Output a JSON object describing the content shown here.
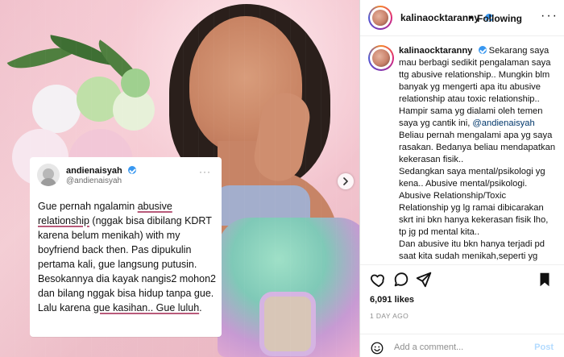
{
  "post": {
    "username": "kalinaocktaranny",
    "follow_state": "Following",
    "likes": "6,091 likes",
    "time_ago": "1 DAY AGO",
    "comment_placeholder": "Add a comment...",
    "post_label": "Post"
  },
  "caption": {
    "username": "kalinaocktaranny",
    "text_before_mention": "Sekarang saya mau berbagi sedikit pengalaman saya ttg abusive relationship.. Mungkin blm banyak yg mengerti apa itu abusive relationship atau toxic relationship.. Hampir sama yg dialami oleh temen saya yg cantik ini, ",
    "mention": "@andienaisyah",
    "text_after_mention": "\nBeliau pernah mengalami apa yg saya rasakan. Bedanya beliau mendapatkan kekerasan fisik..\nSedangkan saya mental/psikologi yg kena.. Abusive mental/psikologi.\nAbusive Relationship/Toxic Relationship yg lg ramai dibicarakan skrt ini bkn hanya kekerasan fisik lho, tp jg pd mental kita..\nDan abusive itu bkn hanya terjadi pd saat kita sudah menikah,seperti yg saya katakan dipostingan saya sebelumnya, jg bs terjadi saat pacaran"
  },
  "tweet": {
    "name": "andienaisyah",
    "handle": "@andienaisyah",
    "more": "···",
    "part1": "Gue pernah ngalamin ",
    "u1": "abusive relationship",
    "part2": " (nggak bisa dibilang KDRT karena belum menikah) with my boyfriend back then. Pas dipukulin pertama kali, gue langsung putusin. Besokannya dia kayak nangis2 mohon2 dan bilang nggak bisa hidup tanpa gue. Lalu karena ",
    "u2": "gue kasihan.. Gue luluh",
    "part3": "."
  },
  "icons": {
    "like": "heart-icon",
    "comment": "comment-icon",
    "share": "share-icon",
    "save": "bookmark-icon",
    "emoji": "emoji-icon",
    "next": "chevron-right-icon"
  },
  "colors": {
    "link": "#00376b",
    "verified": "#3897f0",
    "post_button": "#b3dbff"
  }
}
